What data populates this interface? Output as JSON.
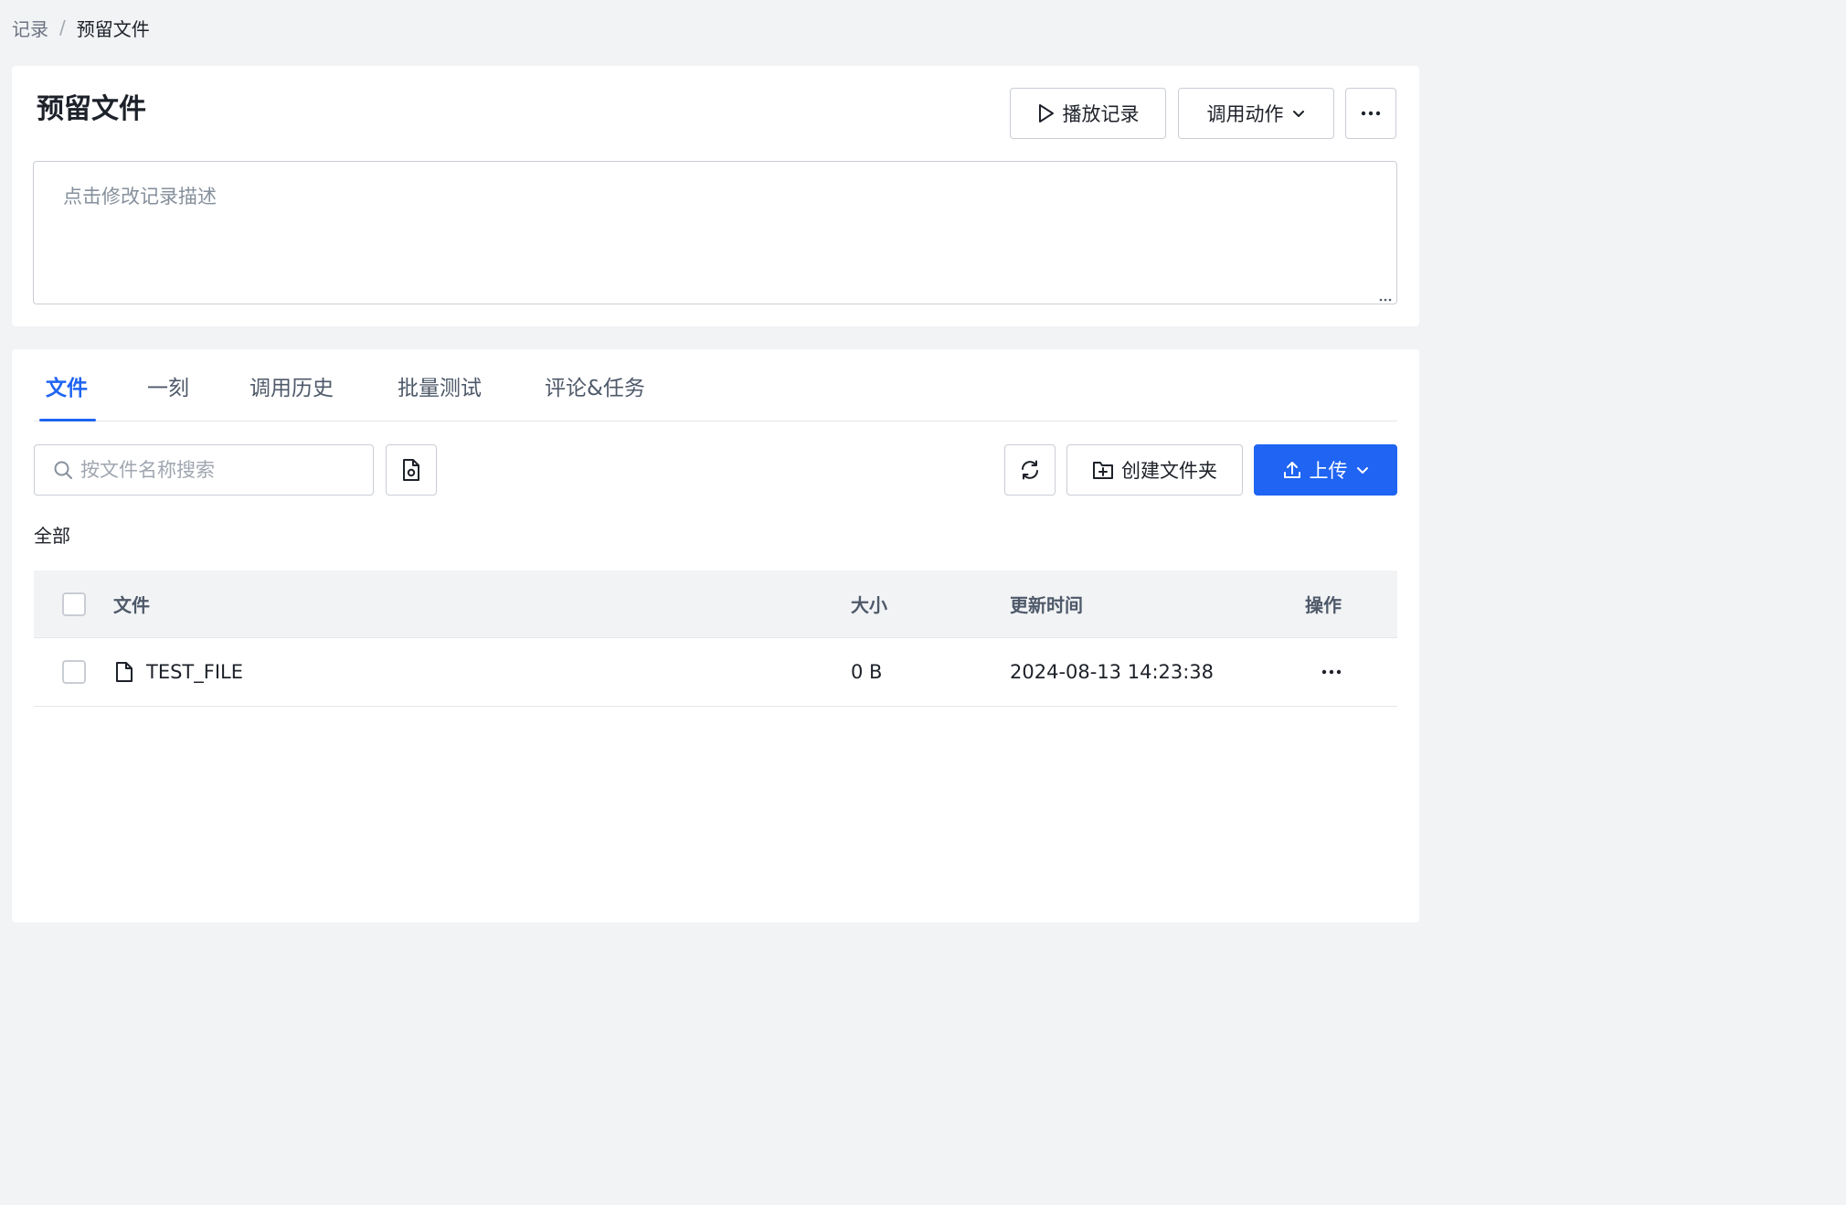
{
  "breadcrumb": {
    "parent": "记录",
    "separator": "/",
    "current": "预留文件"
  },
  "record": {
    "title": "预留文件",
    "description_placeholder": "点击修改记录描述",
    "actions": {
      "play_label": "播放记录",
      "invoke_label": "调用动作"
    }
  },
  "tabs": [
    {
      "label": "文件",
      "active": true
    },
    {
      "label": "一刻",
      "active": false
    },
    {
      "label": "调用历史",
      "active": false
    },
    {
      "label": "批量测试",
      "active": false
    },
    {
      "label": "评论&任务",
      "active": false
    }
  ],
  "toolbar": {
    "search_placeholder": "按文件名称搜索",
    "create_folder_label": "创建文件夹",
    "upload_label": "上传"
  },
  "filter": {
    "current": "全部"
  },
  "table": {
    "headers": {
      "file": "文件",
      "size": "大小",
      "updated": "更新时间",
      "actions": "操作"
    },
    "rows": [
      {
        "name": "TEST_FILE",
        "size": "0 B",
        "updated": "2024-08-13 14:23:38"
      }
    ]
  },
  "colors": {
    "accent": "#1f64f2",
    "border": "#c9cdd4",
    "background": "#f2f3f5"
  },
  "icons": [
    "play-icon",
    "chevron-down-icon",
    "more-icon",
    "search-icon",
    "file-settings-icon",
    "refresh-icon",
    "folder-add-icon",
    "upload-icon",
    "file-icon"
  ]
}
